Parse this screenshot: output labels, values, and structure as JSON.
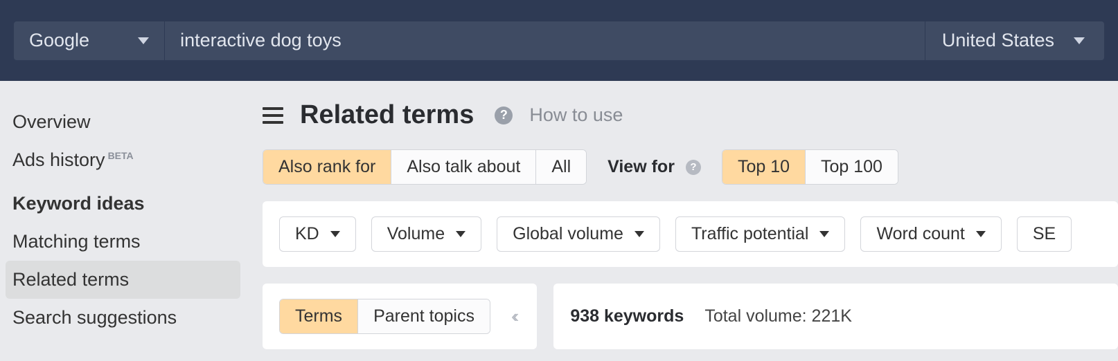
{
  "topbar": {
    "engine": "Google",
    "query": "interactive dog toys",
    "country": "United States"
  },
  "sidebar": {
    "overview": "Overview",
    "ads_history": "Ads history",
    "ads_history_badge": "BETA",
    "section_header": "Keyword ideas",
    "matching_terms": "Matching terms",
    "related_terms": "Related terms",
    "search_suggestions": "Search suggestions"
  },
  "main": {
    "title": "Related terms",
    "how_to_use": "How to use",
    "mode_group": {
      "also_rank_for": "Also rank for",
      "also_talk_about": "Also talk about",
      "all": "All"
    },
    "view_for_label": "View for",
    "view_for_group": {
      "top10": "Top 10",
      "top100": "Top 100"
    },
    "filters": {
      "kd": "KD",
      "volume": "Volume",
      "global_volume": "Global volume",
      "traffic_potential": "Traffic potential",
      "word_count": "Word count",
      "serp": "SE"
    },
    "grouping": {
      "terms": "Terms",
      "parent_topics": "Parent topics"
    },
    "results": {
      "count_label": "938 keywords",
      "total_volume_label": "Total volume: 221K"
    }
  }
}
